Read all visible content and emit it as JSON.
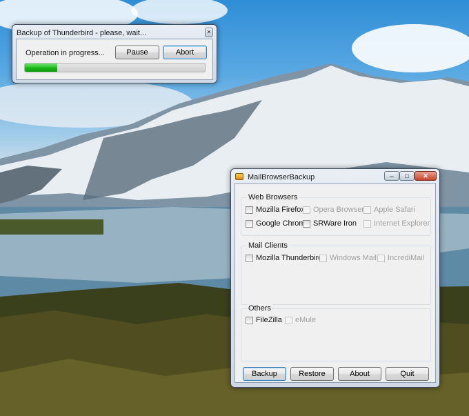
{
  "progress_window": {
    "title": "Backup of Thunderbird - please, wait...",
    "status_text": "Operation in progress...",
    "pause_label": "Pause",
    "abort_label": "Abort",
    "progress_fraction": 0.18,
    "progress_color": "#1fbf1f"
  },
  "main_window": {
    "title": "MailBrowserBackup",
    "groups": {
      "web_browsers": {
        "label": "Web Browsers",
        "items": [
          {
            "label": "Mozilla Firefox",
            "enabled": true
          },
          {
            "label": "Opera Browser",
            "enabled": false
          },
          {
            "label": "Apple Safari",
            "enabled": false
          },
          {
            "label": "Google Chrome",
            "enabled": true
          },
          {
            "label": "SRWare Iron",
            "enabled": true
          },
          {
            "label": "Internet Explorer",
            "enabled": false
          }
        ]
      },
      "mail_clients": {
        "label": "Mail Clients",
        "items": [
          {
            "label": "Mozilla Thunderbird",
            "enabled": true
          },
          {
            "label": "Windows Mail",
            "enabled": false
          },
          {
            "label": "IncrediMail",
            "enabled": false
          }
        ]
      },
      "others": {
        "label": "Others",
        "items": [
          {
            "label": "FileZilla",
            "enabled": true
          },
          {
            "label": "eMule",
            "enabled": false
          }
        ]
      }
    },
    "buttons": {
      "backup": "Backup",
      "restore": "Restore",
      "about": "About",
      "quit": "Quit"
    }
  }
}
